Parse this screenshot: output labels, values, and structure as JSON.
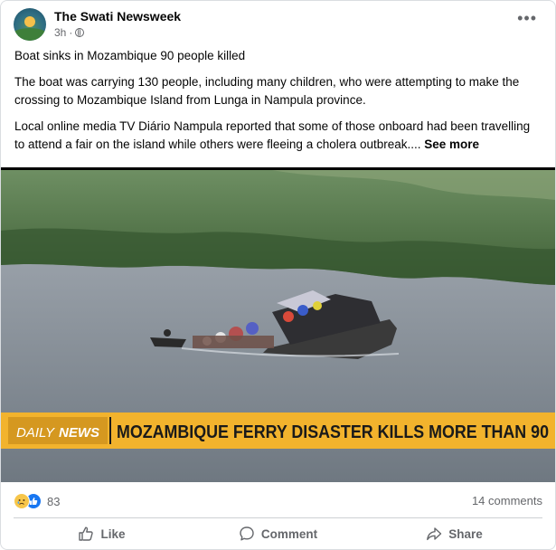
{
  "post": {
    "page_name": "The Swati Newsweek",
    "time": "3h",
    "more_icon": "more-horizontal-icon",
    "paragraphs": [
      "Boat sinks in Mozambique 90 people killed",
      "The  boat was carrying 130 people, including many children, who were attempting to make the crossing to  Mozambique  Island from Lunga in  Nampula province.",
      "Local online media  TV Diário Nampula reported that some of those onboard had been travelling to attend a fair on the island while others were fleeing  a cholera outbreak.... "
    ],
    "see_more": "See more"
  },
  "media": {
    "logo_part1": "DAILY",
    "logo_part2": "NEWS",
    "headline": "MOZAMBIQUE FERRY DISASTER KILLS MORE THAN 90",
    "colors": {
      "ticker_bg": "#f2b32d",
      "logo_bg": "#e0a21f",
      "ticker_text": "#1a1a1a"
    }
  },
  "stats": {
    "reaction_icons": [
      "sad-reaction-icon",
      "like-reaction-icon"
    ],
    "reaction_count": "83",
    "comments": "14 comments"
  },
  "actions": {
    "like": "Like",
    "comment": "Comment",
    "share": "Share"
  }
}
